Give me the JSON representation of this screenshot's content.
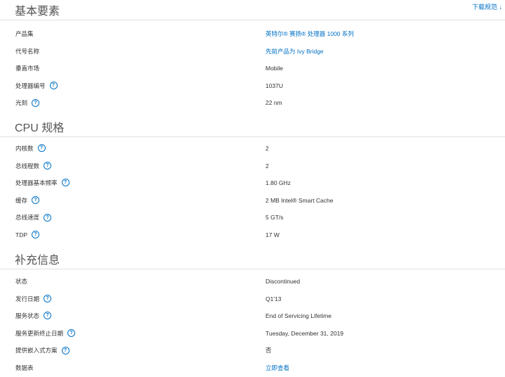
{
  "download_label": "下载规范 ↓",
  "help_glyph": "?",
  "sections": [
    {
      "title": "基本要素",
      "rows": [
        {
          "label": "产品集",
          "value": "英特尔® 赛扬® 处理器 1000 系列",
          "link": true,
          "help": false
        },
        {
          "label": "代号名称",
          "value": "先前产品为 Ivy Bridge",
          "link": true,
          "help": false
        },
        {
          "label": "垂直市场",
          "value": "Mobile",
          "link": false,
          "help": false
        },
        {
          "label": "处理器编号",
          "value": "1037U",
          "link": false,
          "help": true
        },
        {
          "label": "光刻",
          "value": "22 nm",
          "link": false,
          "help": true
        }
      ]
    },
    {
      "title": "CPU 规格",
      "rows": [
        {
          "label": "内核数",
          "value": "2",
          "link": false,
          "help": true
        },
        {
          "label": "总线程数",
          "value": "2",
          "link": false,
          "help": true
        },
        {
          "label": "处理器基本频率",
          "value": "1.80 GHz",
          "link": false,
          "help": true
        },
        {
          "label": "缓存",
          "value": "2 MB Intel® Smart Cache",
          "link": false,
          "help": true
        },
        {
          "label": "总线速度",
          "value": "5 GT/s",
          "link": false,
          "help": true
        },
        {
          "label": "TDP",
          "value": "17 W",
          "link": false,
          "help": true
        }
      ]
    },
    {
      "title": "补充信息",
      "rows": [
        {
          "label": "状态",
          "value": "Discontinued",
          "link": false,
          "help": false
        },
        {
          "label": "发行日期",
          "value": "Q1'13",
          "link": false,
          "help": true
        },
        {
          "label": "服务状态",
          "value": "End of Servicing Lifetime",
          "link": false,
          "help": true
        },
        {
          "label": "服务更新终止日期",
          "value": "Tuesday, December 31, 2019",
          "link": false,
          "help": true
        },
        {
          "label": "提供嵌入式方案",
          "value": "否",
          "link": false,
          "help": true
        },
        {
          "label": "数据表",
          "value": "立即查看",
          "link": true,
          "help": false
        }
      ]
    }
  ]
}
